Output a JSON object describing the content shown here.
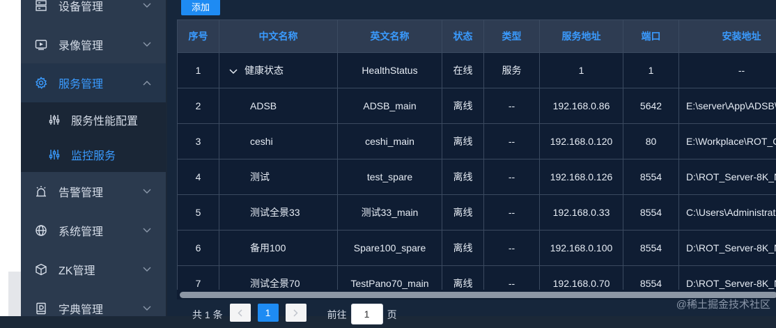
{
  "sidebar": {
    "items": [
      {
        "label": "设备管理",
        "icon": "device-icon"
      },
      {
        "label": "录像管理",
        "icon": "video-icon"
      },
      {
        "label": "服务管理",
        "icon": "gear-icon"
      },
      {
        "label": "告警管理",
        "icon": "alarm-icon"
      },
      {
        "label": "系统管理",
        "icon": "globe-icon"
      },
      {
        "label": "ZK管理",
        "icon": "cube-icon"
      },
      {
        "label": "字典管理",
        "icon": "dictionary-icon"
      }
    ],
    "submenu": [
      {
        "label": "服务性能配置",
        "icon": "sliders-icon"
      },
      {
        "label": "监控服务",
        "icon": "sliders-icon"
      }
    ],
    "accent_color": "#3a9bff"
  },
  "toolbar": {
    "add_label": "添加"
  },
  "table": {
    "headers": [
      "序号",
      "中文名称",
      "英文名称",
      "状态",
      "类型",
      "服务地址",
      "端口",
      "安装地址"
    ],
    "rows": [
      [
        "1",
        "健康状态",
        "HealthStatus",
        "在线",
        "服务",
        "1",
        "1",
        "--"
      ],
      [
        "2",
        "ADSB",
        "ADSB_main",
        "离线",
        "--",
        "192.168.0.86",
        "5642",
        "E:\\server\\App\\ADSB\\"
      ],
      [
        "3",
        "ceshi",
        "ceshi_main",
        "离线",
        "--",
        "192.168.0.120",
        "80",
        "E:\\Workplace\\ROT_C"
      ],
      [
        "4",
        "测试",
        "test_spare",
        "离线",
        "--",
        "192.168.0.126",
        "8554",
        "D:\\ROT_Server-8K_N"
      ],
      [
        "5",
        "测试全景33",
        "测试33_main",
        "离线",
        "--",
        "192.168.0.33",
        "8554",
        "C:\\Users\\Administrat"
      ],
      [
        "6",
        "备用100",
        "Spare100_spare",
        "离线",
        "--",
        "192.168.0.100",
        "8554",
        "D:\\ROT_Server-8K_N"
      ],
      [
        "7",
        "测试全景70",
        "TestPano70_main",
        "离线",
        "--",
        "192.168.0.70",
        "8554",
        "D:\\ROT_Server-8K_N"
      ]
    ]
  },
  "pagination": {
    "total_label": "共 1 条",
    "current_page": "1",
    "goto_label": "前往",
    "goto_value": "1",
    "goto_suffix": "页"
  },
  "watermark": "@稀土掘金技术社区"
}
